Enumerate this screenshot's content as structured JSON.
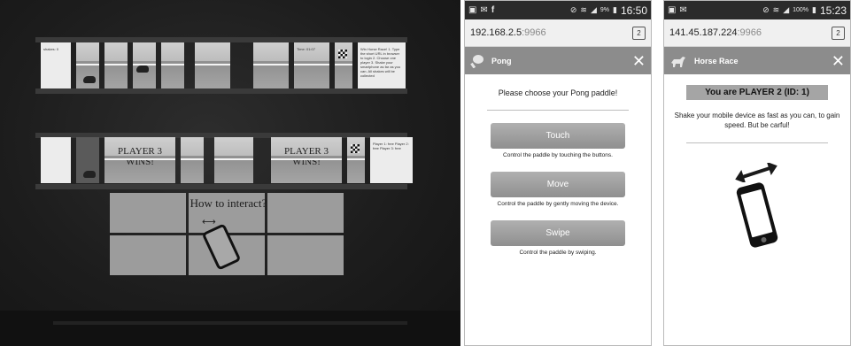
{
  "facade": {
    "panel_r1_time": "Time: 01:07",
    "panel_r1_tiny_left": "shakes: 0",
    "panel_r1_instructions": "Win Horse Race! 1. Type the short URL in browser to login 2. Choose one player 3. Shake your smartphone as far as you can. All shakes will be collected",
    "panel_r1_player": "Player 1: free",
    "player_left_win": "PLAYER 3 WINS!",
    "player_right_win": "PLAYER 3 WINS!",
    "panel_r2_players": "Player 1: free Player 2: free Player 3: free",
    "panel_r2_login": "Login: Connect to http://frontgames",
    "howto": "How to interact?"
  },
  "pong_phone": {
    "status_time": "16:50",
    "status_battery": "9%",
    "url_host": "192.168.2.5",
    "url_port": ":9966",
    "tab_count": "2",
    "app_title": "Pong",
    "close_glyph": "✕",
    "prompt": "Please choose your Pong paddle!",
    "options": [
      {
        "label": "Touch",
        "desc": "Control the paddle by touching the buttons."
      },
      {
        "label": "Move",
        "desc": "Control the paddle by gently moving the device."
      },
      {
        "label": "Swipe",
        "desc": "Control the paddle by swiping."
      }
    ]
  },
  "horse_phone": {
    "status_time": "15:23",
    "status_battery": "100%",
    "url_host": "141.45.187.224",
    "url_port": ":9966",
    "tab_count": "2",
    "app_title": "Horse Race",
    "close_glyph": "✕",
    "player_banner": "You are PLAYER 2 (ID: 1)",
    "instructions": "Shake your mobile device as fast as you can, to gain speed. But be carful!"
  },
  "icons": {
    "statusbar_left": [
      "gallery-icon",
      "message-icon",
      "facebook-icon"
    ],
    "statusbar_right": [
      "mute-icon",
      "wifi-icon",
      "signal-icon",
      "battery-icon"
    ],
    "pong_app": "paddle-icon",
    "horse_app": "horse-icon"
  }
}
